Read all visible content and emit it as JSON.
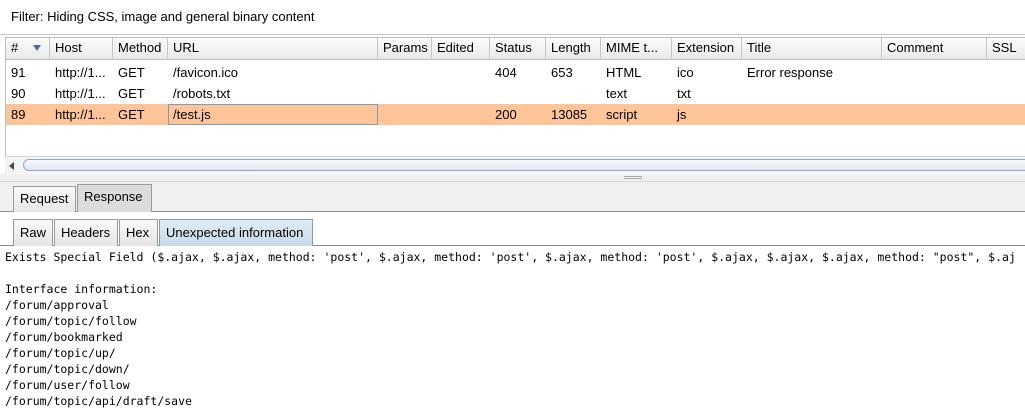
{
  "filter": {
    "text": "Filter: Hiding CSS, image and general binary content"
  },
  "table": {
    "columns": [
      "#",
      "Host",
      "Method",
      "URL",
      "Params",
      "Edited",
      "Status",
      "Length",
      "MIME t...",
      "Extension",
      "Title",
      "Comment",
      "SSL"
    ],
    "rows": [
      {
        "num": "91",
        "host": "http://1...",
        "method": "GET",
        "url": "/favicon.ico",
        "params": "",
        "edited": "",
        "status": "404",
        "length": "653",
        "mime": "HTML",
        "extension": "ico",
        "title": "Error response",
        "comment": "",
        "ssl": ""
      },
      {
        "num": "90",
        "host": "http://1...",
        "method": "GET",
        "url": "/robots.txt",
        "params": "",
        "edited": "",
        "status": "",
        "length": "",
        "mime": "text",
        "extension": "txt",
        "title": "",
        "comment": "",
        "ssl": ""
      },
      {
        "num": "89",
        "host": "http://1...",
        "method": "GET",
        "url": "/test.js",
        "params": "",
        "edited": "",
        "status": "200",
        "length": "13085",
        "mime": "script",
        "extension": "js",
        "title": "",
        "comment": "",
        "ssl": ""
      }
    ],
    "selected_row_color": "#ffc599"
  },
  "tabs": {
    "request": "Request",
    "response": "Response",
    "active": "response"
  },
  "subtabs": {
    "raw": "Raw",
    "headers": "Headers",
    "hex": "Hex",
    "unexpected": "Unexpected information",
    "active": "unexpected"
  },
  "content": {
    "lines": [
      "Exists Special Field ($.ajax, $.ajax, method: 'post', $.ajax, method: 'post', $.ajax, method: 'post', $.ajax, $.ajax, $.ajax, method: \"post\", $.aj",
      "",
      "Interface information:",
      "/forum/approval",
      "/forum/topic/follow",
      "/forum/bookmarked",
      "/forum/topic/up/",
      "/forum/topic/down/",
      "/forum/user/follow",
      "/forum/topic/api/draft/save"
    ]
  }
}
